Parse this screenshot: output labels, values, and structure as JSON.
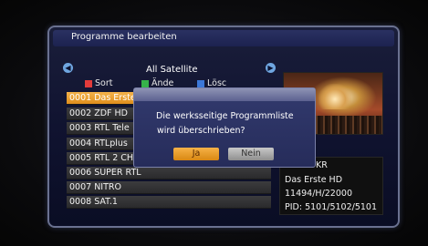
{
  "window": {
    "title": "Programme bearbeiten"
  },
  "list": {
    "satellite": "All Satellite",
    "legend": [
      {
        "label": "Sort",
        "color": "#e23b3b"
      },
      {
        "label": "Ände",
        "color": "#36b34a"
      },
      {
        "label": "Lösc",
        "color": "#3c78d8"
      }
    ],
    "channels": [
      {
        "label": "0001 Das Erste",
        "selected": true
      },
      {
        "label": "0002 ZDF HD"
      },
      {
        "label": "0003 RTL Tele"
      },
      {
        "label": "0004 RTLplus"
      },
      {
        "label": "0005 RTL 2 CH"
      },
      {
        "label": "0006 SUPER RTL"
      },
      {
        "label": "0007 NITRO"
      },
      {
        "label": "0008 SAT.1"
      }
    ]
  },
  "info": {
    "lines": [
      "KR",
      "Das Erste HD",
      "11494/H/22000",
      "PID: 5101/5102/5101"
    ]
  },
  "dialog": {
    "message_line1": "Die werksseitige Programmliste",
    "message_line2": "wird überschrieben?",
    "yes_label": "Ja",
    "no_label": "Nein"
  },
  "icons": {
    "left": "arrow-left-icon",
    "right": "arrow-right-icon"
  }
}
